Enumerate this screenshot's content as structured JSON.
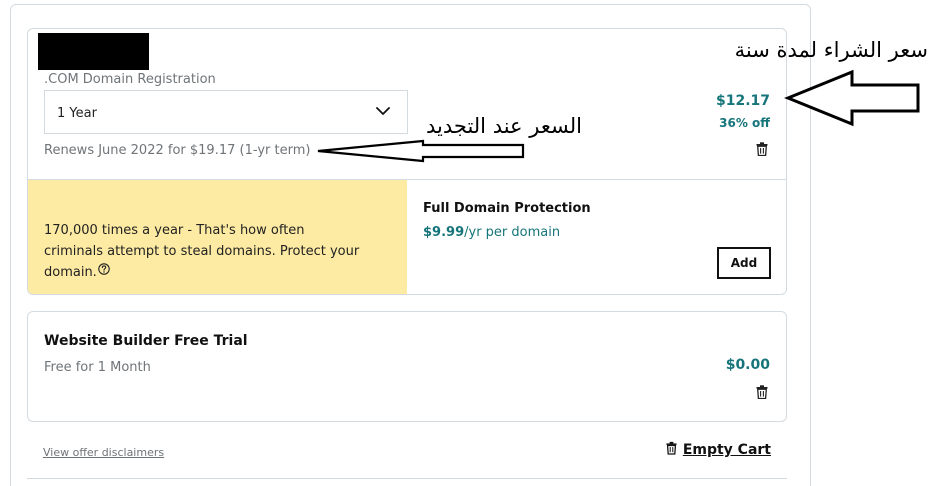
{
  "domain_item": {
    "type_label": ".COM Domain Registration",
    "term_select": "1 Year",
    "renewal_text": "Renews June 2022 for $19.17 (1-yr term)",
    "price": "$12.17",
    "discount": "36% off",
    "delete_icon": "trash-icon"
  },
  "protection": {
    "promo_text": "170,000 times a year - That's how often criminals attempt to steal domains. Protect your domain.",
    "promo_help_icon": "question-circle-icon",
    "title": "Full Domain Protection",
    "price": "$9.99",
    "price_suffix": "/yr per domain",
    "add_label": "Add",
    "promo_bg": "#fdeba3"
  },
  "website_builder": {
    "title": "Website Builder Free Trial",
    "subtitle": "Free for 1 Month",
    "price": "$0.00",
    "delete_icon": "trash-icon"
  },
  "footer": {
    "disclaimer_link": "View offer disclaimers",
    "empty_cart_label": "Empty Cart"
  },
  "annotations": {
    "purchase_price": "سعر الشراء لمدة سنة",
    "renewal_price": "السعر عند التجديد"
  },
  "colors": {
    "accent": "#16757a",
    "border": "#d4dbe0",
    "muted_text": "#6f7478"
  }
}
